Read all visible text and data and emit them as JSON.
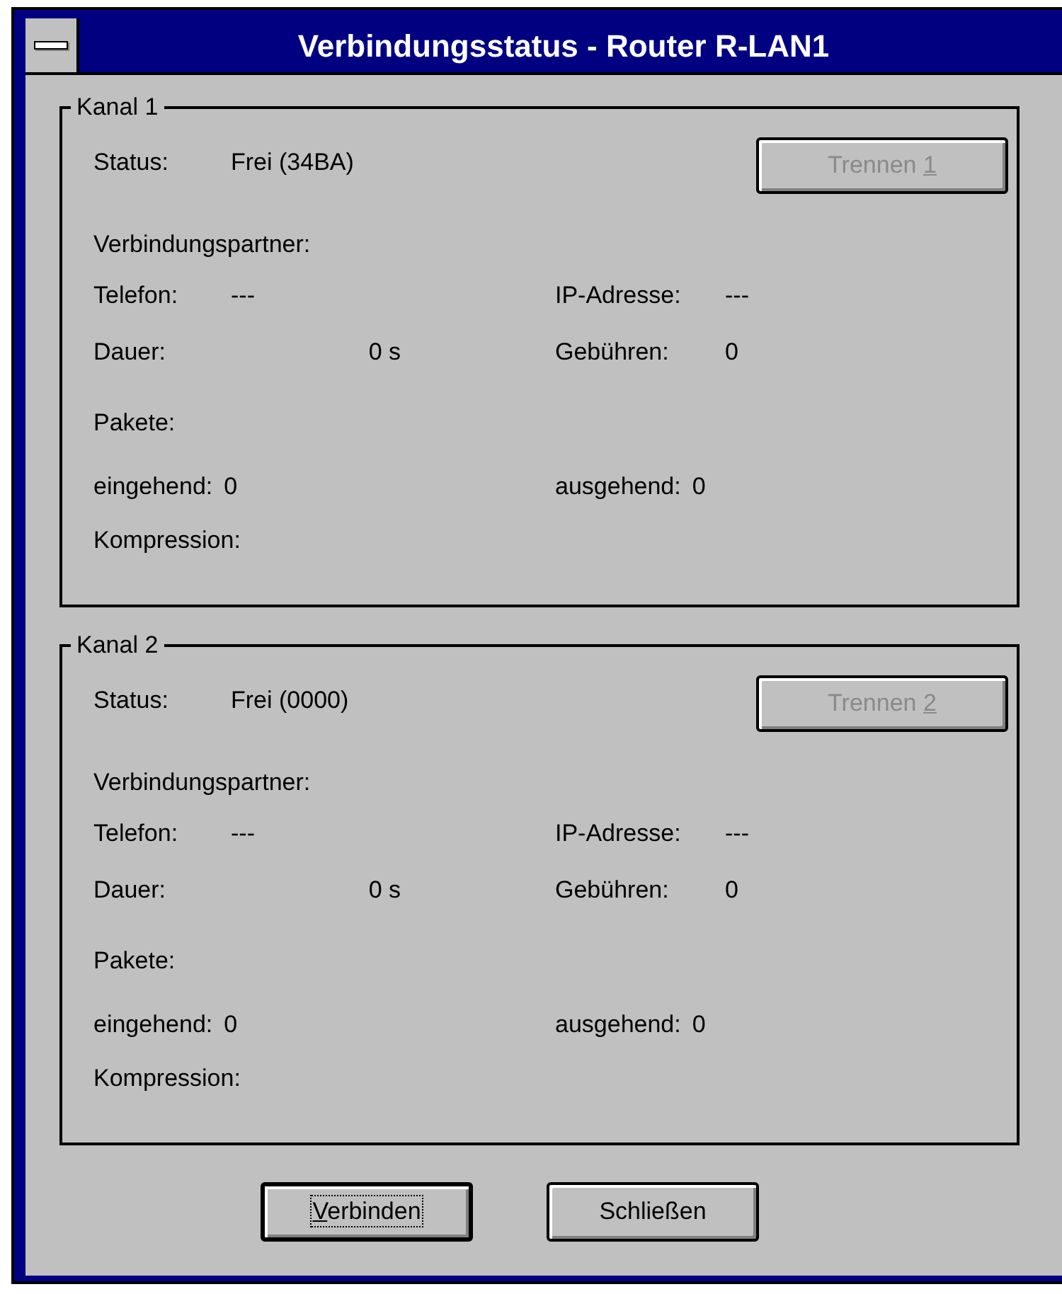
{
  "window": {
    "title": "Verbindungsstatus - Router R-LAN1"
  },
  "channels": [
    {
      "title": "Kanal 1",
      "status_label": "Status:",
      "status_value": "Frei (34BA)",
      "disconnect_button": {
        "before": "Trennen ",
        "accelerator": "1",
        "disabled": true
      },
      "partner_label": "Verbindungspartner:",
      "rows": [
        [
          {
            "kind": "tabbed",
            "label": "Telefon:",
            "value": "---"
          },
          {
            "kind": "tabbed",
            "label": "IP-Adresse:",
            "value": "---"
          }
        ],
        [
          {
            "kind": "right",
            "label": "Dauer:",
            "value": "0 s"
          },
          {
            "kind": "tabbed",
            "label": "Gebühren:",
            "value": "0"
          }
        ]
      ],
      "packets_label": "Pakete:",
      "packet_rows": [
        [
          {
            "kind": "inline",
            "label": "eingehend:",
            "value": "0"
          },
          {
            "kind": "inline",
            "label": "ausgehend:",
            "value": "0"
          }
        ]
      ],
      "compression_label": "Kompression:"
    },
    {
      "title": "Kanal 2",
      "status_label": "Status:",
      "status_value": "Frei (0000)",
      "disconnect_button": {
        "before": "Trennen ",
        "accelerator": "2",
        "disabled": true
      },
      "partner_label": "Verbindungspartner:",
      "rows": [
        [
          {
            "kind": "tabbed",
            "label": "Telefon:",
            "value": "---"
          },
          {
            "kind": "tabbed",
            "label": "IP-Adresse:",
            "value": "---"
          }
        ],
        [
          {
            "kind": "right",
            "label": "Dauer:",
            "value": "0 s"
          },
          {
            "kind": "tabbed",
            "label": "Gebühren:",
            "value": "0"
          }
        ]
      ],
      "packets_label": "Pakete:",
      "packet_rows": [
        [
          {
            "kind": "inline",
            "label": "eingehend:",
            "value": "0"
          },
          {
            "kind": "inline",
            "label": "ausgehend:",
            "value": "0"
          }
        ]
      ],
      "compression_label": "Kompression:"
    }
  ],
  "buttons": [
    {
      "accelerator": "V",
      "after": "erbinden",
      "default": true,
      "focused": true
    },
    {
      "before": "Schließen",
      "default": false,
      "focused": false
    }
  ]
}
